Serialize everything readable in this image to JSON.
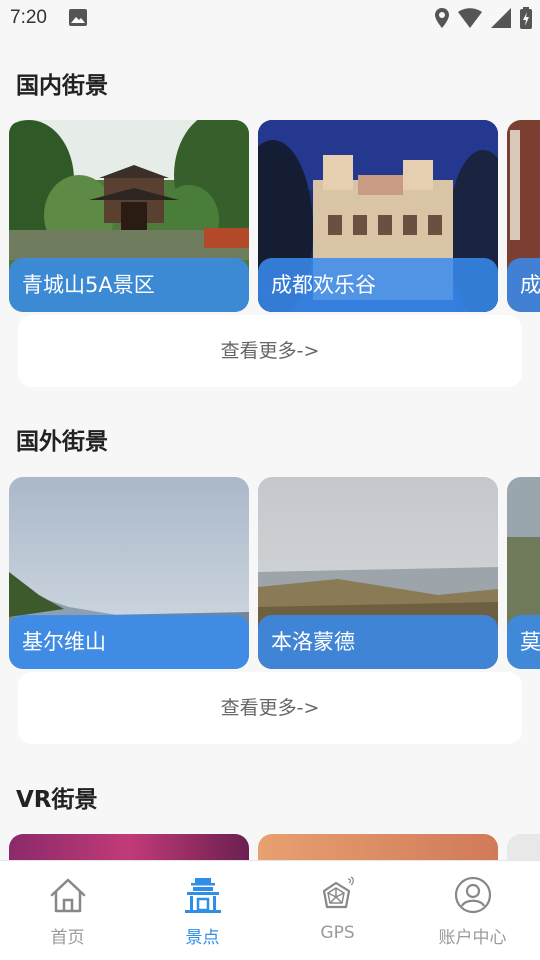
{
  "status_bar": {
    "time": "7:20"
  },
  "sections": [
    {
      "title": "国内街景",
      "cards": [
        {
          "label": "青城山5A景区"
        },
        {
          "label": "成都欢乐谷"
        },
        {
          "label": "成"
        }
      ],
      "more_label": "查看更多->"
    },
    {
      "title": "国外街景",
      "cards": [
        {
          "label": "基尔维山"
        },
        {
          "label": "本洛蒙德"
        },
        {
          "label": "莫"
        }
      ],
      "more_label": "查看更多->"
    },
    {
      "title": "VR街景"
    }
  ],
  "bottom_nav": {
    "items": [
      {
        "label": "首页",
        "icon": "home-icon"
      },
      {
        "label": "景点",
        "icon": "scenic-spot-icon",
        "active": true
      },
      {
        "label": "GPS",
        "icon": "gps-icon"
      },
      {
        "label": "账户中心",
        "icon": "account-icon"
      }
    ]
  },
  "colors": {
    "accent": "#2f8fe8",
    "label_overlay": "#388cf0",
    "background": "#f7f7f7"
  }
}
